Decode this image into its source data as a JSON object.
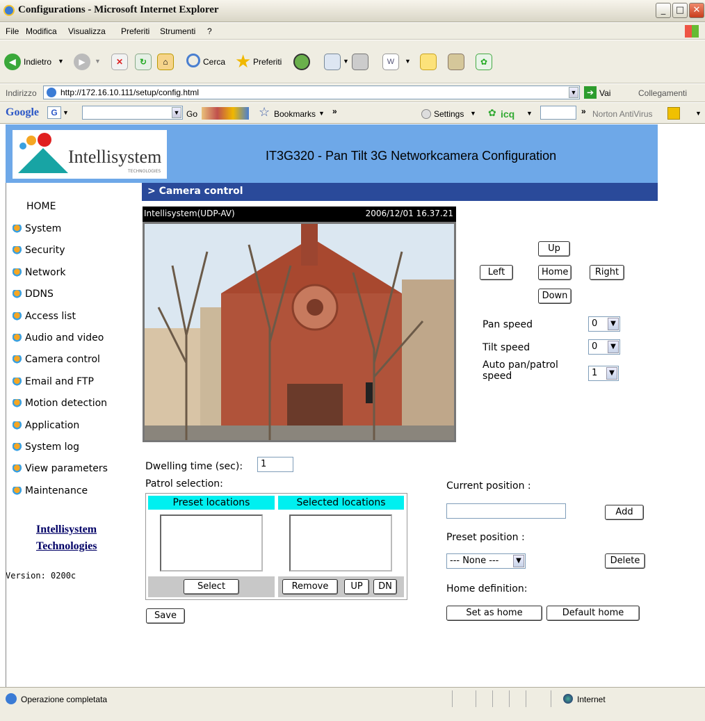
{
  "window": {
    "title": "Configurations - Microsoft Internet Explorer"
  },
  "menu": [
    "File",
    "Modifica",
    "Visualizza",
    "Preferiti",
    "Strumenti",
    "?"
  ],
  "toolbar": {
    "back": "Indietro",
    "search": "Cerca",
    "favorites": "Preferiti"
  },
  "address": {
    "label": "Indirizzo",
    "url": "http://172.16.10.111/setup/config.html",
    "go": "Vai",
    "links": "Collegamenti"
  },
  "googlebar": {
    "logo": "Google",
    "go": "Go",
    "bookmarks": "Bookmarks",
    "settings": "Settings",
    "icq": "icq",
    "norton": "Norton AntiVirus"
  },
  "banner": {
    "logo_text": "Intellisystem",
    "logo_sub": "TECHNOLOGIES",
    "title": "IT3G320 - Pan Tilt 3G Networkcamera Configuration"
  },
  "nav": {
    "home": "HOME",
    "items": [
      "System",
      "Security",
      "Network",
      "DDNS",
      "Access list",
      "Audio and video",
      "Camera control",
      "Email and FTP",
      "Motion detection",
      "Application",
      "System log",
      "View parameters",
      "Maintenance"
    ],
    "company_line1": "Intellisystem",
    "company_line2": "Technologies",
    "version": "Version: 0200c"
  },
  "section": {
    "title": "> Camera control"
  },
  "camera": {
    "name": "Intellisystem(UDP-AV)",
    "timestamp": "2006/12/01 16.37.21"
  },
  "ptz": {
    "up": "Up",
    "left": "Left",
    "home": "Home",
    "right": "Right",
    "down": "Down"
  },
  "speed": {
    "pan_label": "Pan speed",
    "pan_value": "0",
    "tilt_label": "Tilt speed",
    "tilt_value": "0",
    "auto_label_1": "Auto pan/patrol",
    "auto_label_2": "speed",
    "auto_value": "1"
  },
  "dwelling": {
    "label": "Dwelling time (sec):",
    "value": "1"
  },
  "patrol": {
    "label": "Patrol selection:",
    "preset_header": "Preset locations",
    "selected_header": "Selected locations",
    "select_btn": "Select",
    "remove_btn": "Remove",
    "up_btn": "UP",
    "dn_btn": "DN"
  },
  "save_btn": "Save",
  "position": {
    "current_label": "Current position :",
    "current_value": "",
    "add_btn": "Add",
    "preset_label": "Preset position :",
    "preset_value": "--- None ---",
    "delete_btn": "Delete",
    "home_label": "Home definition:",
    "set_home_btn": "Set as home",
    "default_home_btn": "Default home"
  },
  "status": {
    "text": "Operazione completata",
    "zone": "Internet"
  },
  "colors": {
    "banner": "#6ea8e8",
    "section_bar": "#2a4a9a",
    "table_header": "#00f0f0"
  }
}
